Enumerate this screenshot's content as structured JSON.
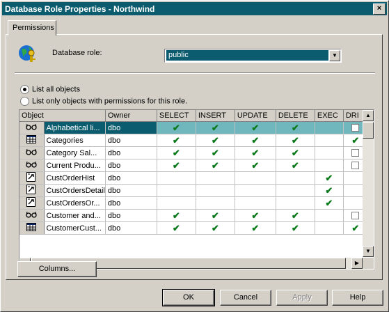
{
  "window": {
    "title": "Database Role Properties - Northwind",
    "close_glyph": "×"
  },
  "tabs": [
    {
      "label": "Permissions"
    }
  ],
  "role": {
    "label": "Database role:",
    "value": "public"
  },
  "options": {
    "list_all": "List all objects",
    "list_permitted": "List only objects with permissions for this role.",
    "selected": "list_all"
  },
  "grid": {
    "columns": [
      "Object",
      "Owner",
      "SELECT",
      "INSERT",
      "UPDATE",
      "DELETE",
      "EXEC",
      "DRI"
    ],
    "rows": [
      {
        "icon": "view-icon",
        "object": "Alphabetical li...",
        "owner": "dbo",
        "select": true,
        "insert": true,
        "update": true,
        "delete": true,
        "exec": null,
        "dri": false,
        "selected": true
      },
      {
        "icon": "table-icon",
        "object": "Categories",
        "owner": "dbo",
        "select": true,
        "insert": true,
        "update": true,
        "delete": true,
        "exec": null,
        "dri": true
      },
      {
        "icon": "view-icon",
        "object": "Category Sal...",
        "owner": "dbo",
        "select": true,
        "insert": true,
        "update": true,
        "delete": true,
        "exec": null,
        "dri": false
      },
      {
        "icon": "view-icon",
        "object": "Current Produ...",
        "owner": "dbo",
        "select": true,
        "insert": true,
        "update": true,
        "delete": true,
        "exec": null,
        "dri": false
      },
      {
        "icon": "stored-procedure-icon",
        "object": "CustOrderHist",
        "owner": "dbo",
        "select": null,
        "insert": null,
        "update": null,
        "delete": null,
        "exec": true,
        "dri": null
      },
      {
        "icon": "stored-procedure-icon",
        "object": "CustOrdersDetail",
        "owner": "dbo",
        "select": null,
        "insert": null,
        "update": null,
        "delete": null,
        "exec": true,
        "dri": null
      },
      {
        "icon": "stored-procedure-icon",
        "object": "CustOrdersOr...",
        "owner": "dbo",
        "select": null,
        "insert": null,
        "update": null,
        "delete": null,
        "exec": true,
        "dri": null
      },
      {
        "icon": "view-icon",
        "object": "Customer and...",
        "owner": "dbo",
        "select": true,
        "insert": true,
        "update": true,
        "delete": true,
        "exec": null,
        "dri": false
      },
      {
        "icon": "table-icon",
        "object": "CustomerCust...",
        "owner": "dbo",
        "select": true,
        "insert": true,
        "update": true,
        "delete": true,
        "exec": null,
        "dri": true
      }
    ]
  },
  "buttons": {
    "columns": "Columns...",
    "ok": "OK",
    "cancel": "Cancel",
    "apply": "Apply",
    "help": "Help"
  },
  "colors": {
    "title_bar": "#0a5c6e",
    "check": "#0a7a1a",
    "selected_row": "#0a5c6e",
    "face": "#d4d0c8"
  }
}
